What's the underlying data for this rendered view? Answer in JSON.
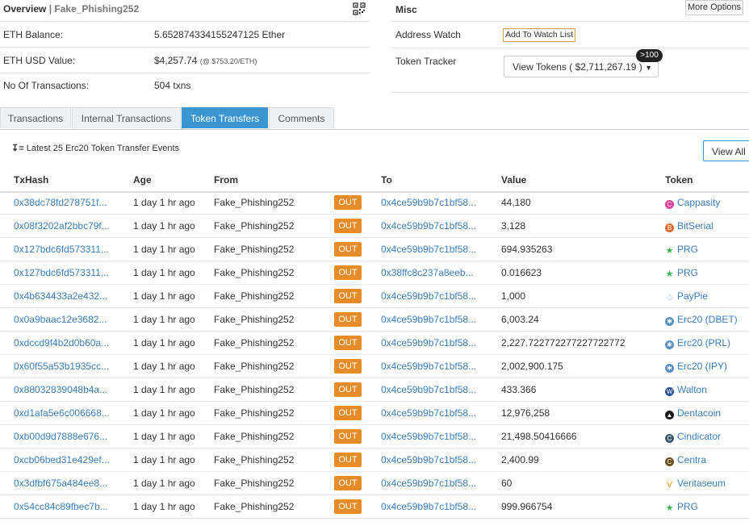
{
  "overview": {
    "title": "Overview",
    "separator": " | ",
    "name": "Fake_Phishing252",
    "balance_label": "ETH Balance:",
    "balance_value": "5.652874334155247125 Ether",
    "usd_label": "ETH USD Value:",
    "usd_value": "$4,257.74",
    "usd_rate": "(@ $753.20/ETH)",
    "tx_label": "No Of Transactions:",
    "tx_value": "504 txns"
  },
  "misc": {
    "title": "Misc",
    "more_options": "More Options",
    "address_watch_label": "Address Watch",
    "add_watch": "Add To Watch List",
    "token_tracker_label": "Token Tracker",
    "view_tokens": "View Tokens ( $2,711,267.19 )",
    "tokens_badge": ">100"
  },
  "tabs": [
    "Transactions",
    "Internal Transactions",
    "Token Transfers",
    "Comments"
  ],
  "active_tab": 2,
  "events_title": "Latest 25 Erc20 Token Transfer Events",
  "view_all": "View All",
  "columns": {
    "txhash": "TxHash",
    "age": "Age",
    "from": "From",
    "to": "To",
    "value": "Value",
    "token": "Token"
  },
  "rows": [
    {
      "tx": "0x38dc78fd278751f...",
      "age": "1 day 1 hr ago",
      "from": "Fake_Phishing252",
      "dir": "OUT",
      "to": "0x4ce59b9b7c1bf58...",
      "value": "44,180",
      "token": "Cappasity",
      "icon": "cappasity-icon",
      "color": "#e0409a"
    },
    {
      "tx": "0x08f3202af2bbc79f...",
      "age": "1 day 1 hr ago",
      "from": "Fake_Phishing252",
      "dir": "OUT",
      "to": "0x4ce59b9b7c1bf58...",
      "value": "3,128",
      "token": "BitSerial",
      "icon": "bitserial-icon",
      "color": "#e36a2b"
    },
    {
      "tx": "0x127bdc6fd573311...",
      "age": "1 day 1 hr ago",
      "from": "Fake_Phishing252",
      "dir": "OUT",
      "to": "0x4ce59b9b7c1bf58...",
      "value": "694.935263",
      "token": "PRG",
      "icon": "prg-icon",
      "color": "#3ab54a"
    },
    {
      "tx": "0x127bdc6fd573311...",
      "age": "1 day 1 hr ago",
      "from": "Fake_Phishing252",
      "dir": "OUT",
      "to": "0x38ffc8c237a8eeb...",
      "value": "0.016623",
      "token": "PRG",
      "icon": "prg-icon",
      "color": "#3ab54a"
    },
    {
      "tx": "0x4b634433a2e432...",
      "age": "1 day 1 hr ago",
      "from": "Fake_Phishing252",
      "dir": "OUT",
      "to": "0x4ce59b9b7c1bf58...",
      "value": "1,000",
      "token": "PayPie",
      "icon": "paypie-icon",
      "color": "#9bb7d4"
    },
    {
      "tx": "0x0a9baac12e3682...",
      "age": "1 day 1 hr ago",
      "from": "Fake_Phishing252",
      "dir": "OUT",
      "to": "0x4ce59b9b7c1bf58...",
      "value": "6,003.24",
      "token": "Erc20 (DBET)",
      "icon": "erc20-icon",
      "color": "#5b8fc7"
    },
    {
      "tx": "0xdccd9f4b2d0b60a...",
      "age": "1 day 1 hr ago",
      "from": "Fake_Phishing252",
      "dir": "OUT",
      "to": "0x4ce59b9b7c1bf58...",
      "value": "2,227.722772277227722772",
      "token": "Erc20 (PRL)",
      "icon": "erc20-icon",
      "color": "#5b8fc7"
    },
    {
      "tx": "0x60f55a53b1935cc...",
      "age": "1 day 1 hr ago",
      "from": "Fake_Phishing252",
      "dir": "OUT",
      "to": "0x4ce59b9b7c1bf58...",
      "value": "2,002,900.175",
      "token": "Erc20 (IPY)",
      "icon": "erc20-icon",
      "color": "#5b8fc7"
    },
    {
      "tx": "0x88032839048b4a...",
      "age": "1 day 1 hr ago",
      "from": "Fake_Phishing252",
      "dir": "OUT",
      "to": "0x4ce59b9b7c1bf58...",
      "value": "433.366",
      "token": "Walton",
      "icon": "walton-icon",
      "color": "#2a4fa0"
    },
    {
      "tx": "0xd1afa5e6c006668...",
      "age": "1 day 1 hr ago",
      "from": "Fake_Phishing252",
      "dir": "OUT",
      "to": "0x4ce59b9b7c1bf58...",
      "value": "12,976,258",
      "token": "Dentacoin",
      "icon": "dentacoin-icon",
      "color": "#1a1a1a"
    },
    {
      "tx": "0xb00d9d7888e676...",
      "age": "1 day 1 hr ago",
      "from": "Fake_Phishing252",
      "dir": "OUT",
      "to": "0x4ce59b9b7c1bf58...",
      "value": "21,498.50416666",
      "token": "Cindicator",
      "icon": "cindicator-icon",
      "color": "#3f5a6e"
    },
    {
      "tx": "0xcb06bed31e429ef...",
      "age": "1 day 1 hr ago",
      "from": "Fake_Phishing252",
      "dir": "OUT",
      "to": "0x4ce59b9b7c1bf58...",
      "value": "2,400.99",
      "token": "Centra",
      "icon": "centra-icon",
      "color": "#6b4e1e"
    },
    {
      "tx": "0x3dfbf675a484ee8...",
      "age": "1 day 1 hr ago",
      "from": "Fake_Phishing252",
      "dir": "OUT",
      "to": "0x4ce59b9b7c1bf58...",
      "value": "60",
      "token": "Veritaseum",
      "icon": "veritaseum-icon",
      "color": "#f2a31b"
    },
    {
      "tx": "0x54cc84c89fbec7b...",
      "age": "1 day 1 hr ago",
      "from": "Fake_Phishing252",
      "dir": "OUT",
      "to": "0x4ce59b9b7c1bf58...",
      "value": "999.966754",
      "token": "PRG",
      "icon": "prg-icon",
      "color": "#3ab54a"
    }
  ]
}
